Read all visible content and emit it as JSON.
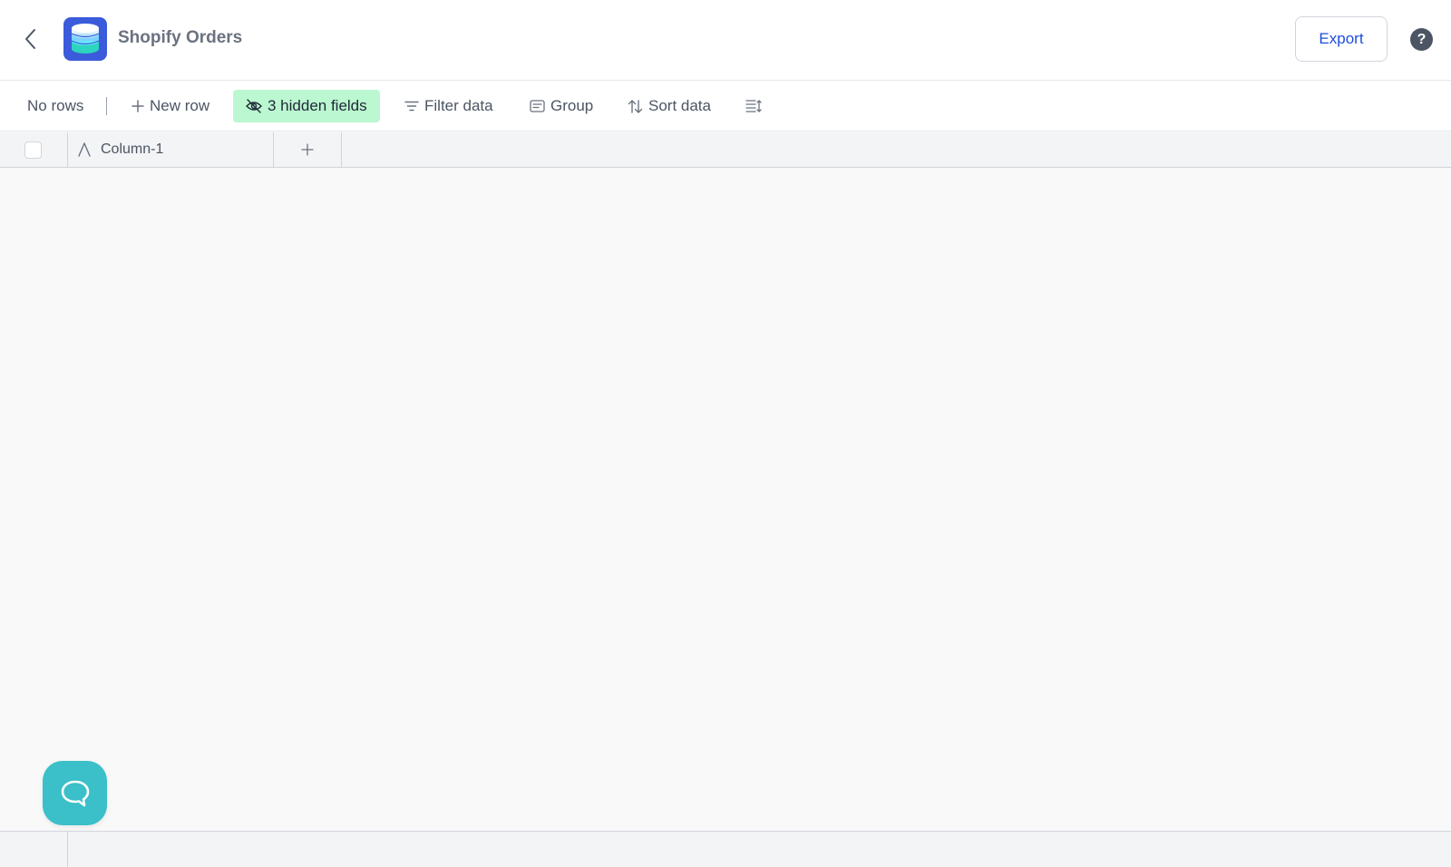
{
  "header": {
    "title": "Shopify Orders",
    "back_icon": "chevron-left-icon",
    "logo_icon": "database-icon",
    "export_label": "Export",
    "help_label": "?"
  },
  "toolbar": {
    "row_count": "No rows",
    "new_row_label": "New row",
    "hidden_fields_label": "3 hidden fields",
    "filter_label": "Filter data",
    "group_label": "Group",
    "sort_label": "Sort data"
  },
  "grid": {
    "columns": [
      {
        "label": "Column-1",
        "type_icon": "text-type-icon"
      }
    ],
    "add_column_icon": "plus-icon"
  },
  "colors": {
    "accent": "#1d4ed8",
    "logo_bg": "#3b5bdb",
    "hidden_fields_bg": "#bbf7d0",
    "chat_bg": "#3bbfc9"
  }
}
